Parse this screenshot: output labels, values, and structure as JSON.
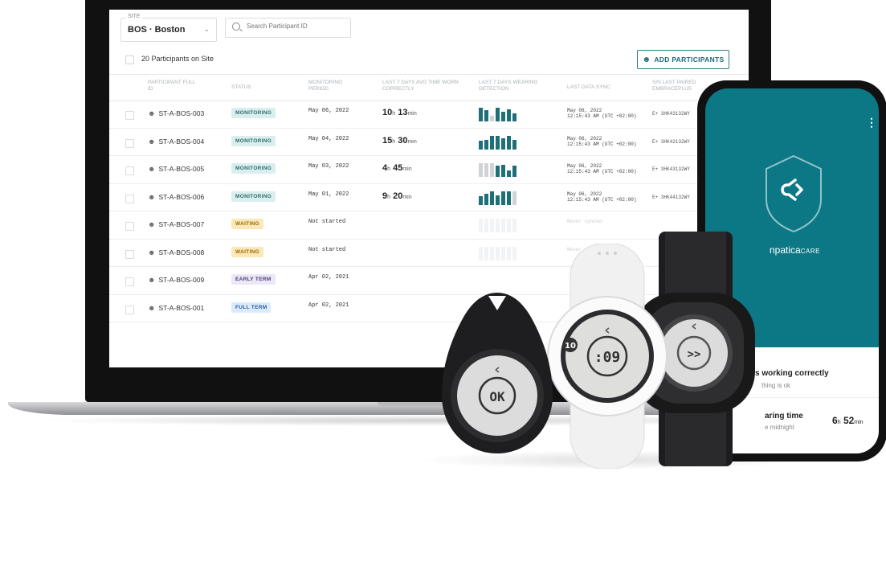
{
  "dashboard": {
    "site_label": "SITE",
    "site_value": "BOS · Boston",
    "search_placeholder": "Search Participant ID",
    "participant_count": "20 Participants on Site",
    "add_button": "ADD PARTICIPANTS",
    "headers": {
      "participant": "PARTICIPANT FULL ID",
      "status": "STATUS",
      "period": "MONITORING PERIOD",
      "wear": "LAST 7 DAYS AVG TIME WORN CORRECTLY",
      "detection": "LAST 7 DAYS WEARING DETECTION",
      "sync": "LAST DATA SYNC",
      "serial": "S/N LAST PAIRED EMBRACEPLUS"
    },
    "rows": [
      {
        "id": "ST-A-BOS-003",
        "status": "MONITORING",
        "period": "May 06, 2022",
        "wear_h": "10",
        "wear_m": "13",
        "bars": [
          1,
          0.8,
          0.4,
          1,
          0.7,
          0.9,
          0.6
        ],
        "bar_colors": [
          "#1f6f78",
          "#1f6f78",
          "#cfd3d6",
          "#1f6f78",
          "#1f6f78",
          "#1f6f78",
          "#1f6f78"
        ],
        "sync": "May 06, 2022",
        "sync_time": "12:15:43 AM (UTC +02:00)",
        "serial": "E+ 3HK43132WY"
      },
      {
        "id": "ST-A-BOS-004",
        "status": "MONITORING",
        "period": "May 04, 2022",
        "wear_h": "15",
        "wear_m": "30",
        "bars": [
          0.6,
          0.7,
          1,
          1,
          0.8,
          1,
          0.7
        ],
        "bar_colors": [
          "#1f6f78",
          "#1f6f78",
          "#1f6f78",
          "#1f6f78",
          "#1f6f78",
          "#1f6f78",
          "#1f6f78"
        ],
        "sync": "May 06, 2022",
        "sync_time": "12:15:43 AM (UTC +02:00)",
        "serial": "E+ 3HK42132WY"
      },
      {
        "id": "ST-A-BOS-005",
        "status": "MONITORING",
        "period": "May 03, 2022",
        "wear_h": "4",
        "wear_m": "45",
        "bars": [
          1,
          1,
          1,
          0.8,
          0.9,
          0.5,
          0.8
        ],
        "bar_colors": [
          "#cfd3d6",
          "#cfd3d6",
          "#cfd3d6",
          "#1f6f78",
          "#1f6f78",
          "#1f6f78",
          "#1f6f78"
        ],
        "sync": "May 06, 2022",
        "sync_time": "12:15:43 AM (UTC +02:00)",
        "serial": "E+ 3HK43132WY"
      },
      {
        "id": "ST-A-BOS-006",
        "status": "MONITORING",
        "period": "May 01, 2022",
        "wear_h": "9",
        "wear_m": "20",
        "bars": [
          0.6,
          0.8,
          1,
          0.7,
          1,
          1,
          1
        ],
        "bar_colors": [
          "#1f6f78",
          "#1f6f78",
          "#1f6f78",
          "#1f6f78",
          "#1f6f78",
          "#1f6f78",
          "#cfd3d6"
        ],
        "sync": "May 06, 2022",
        "sync_time": "12:15:43 AM (UTC +02:00)",
        "serial": "E+ 3HK44132WY"
      },
      {
        "id": "ST-A-BOS-007",
        "status": "WAITING",
        "period": "Not started",
        "wear_h": "",
        "wear_m": "",
        "bars": [
          1,
          1,
          1,
          1,
          1,
          1,
          1
        ],
        "bar_colors": [
          "#f2f3f4",
          "#f2f3f4",
          "#f2f3f4",
          "#f2f3f4",
          "#f2f3f4",
          "#f2f3f4",
          "#f2f3f4"
        ],
        "sync": "Never synced",
        "sync_time": "",
        "serial": ""
      },
      {
        "id": "ST-A-BOS-008",
        "status": "WAITING",
        "period": "Not started",
        "wear_h": "",
        "wear_m": "",
        "bars": [
          1,
          1,
          1,
          1,
          1,
          1,
          1
        ],
        "bar_colors": [
          "#f2f3f4",
          "#f2f3f4",
          "#f2f3f4",
          "#f2f3f4",
          "#f2f3f4",
          "#f2f3f4",
          "#f2f3f4"
        ],
        "sync": "Never synced",
        "sync_time": "",
        "serial": ""
      },
      {
        "id": "ST-A-BOS-009",
        "status": "EARLY TERM",
        "period": "Apr 02, 2021",
        "wear_h": "",
        "wear_m": "",
        "bars": [],
        "bar_colors": [],
        "sync": "",
        "sync_time": "",
        "serial": ""
      },
      {
        "id": "ST-A-BOS-001",
        "status": "FULL TERM",
        "period": "Apr 02, 2021",
        "wear_h": "",
        "wear_m": "",
        "bars": [],
        "bar_colors": [],
        "sync": "",
        "sync_time": "",
        "serial": ""
      }
    ]
  },
  "phone": {
    "brand_partial": "npatica",
    "brand_suffix": "CARE",
    "status_title": "s working correctly",
    "status_sub": "thing is ok",
    "wear_title": "aring time",
    "wear_sub": "e midnight",
    "wear_h": "6",
    "wear_m": "52",
    "unit_h": "h",
    "unit_m": "min"
  },
  "devices": {
    "keyfob_display": "OK",
    "watch_display": ":09",
    "watch_badge": "10",
    "band_display": ">>"
  },
  "colors": {
    "teal": "#0d7885",
    "bar_active": "#1f6f78",
    "bar_inactive": "#cfd3d6"
  }
}
